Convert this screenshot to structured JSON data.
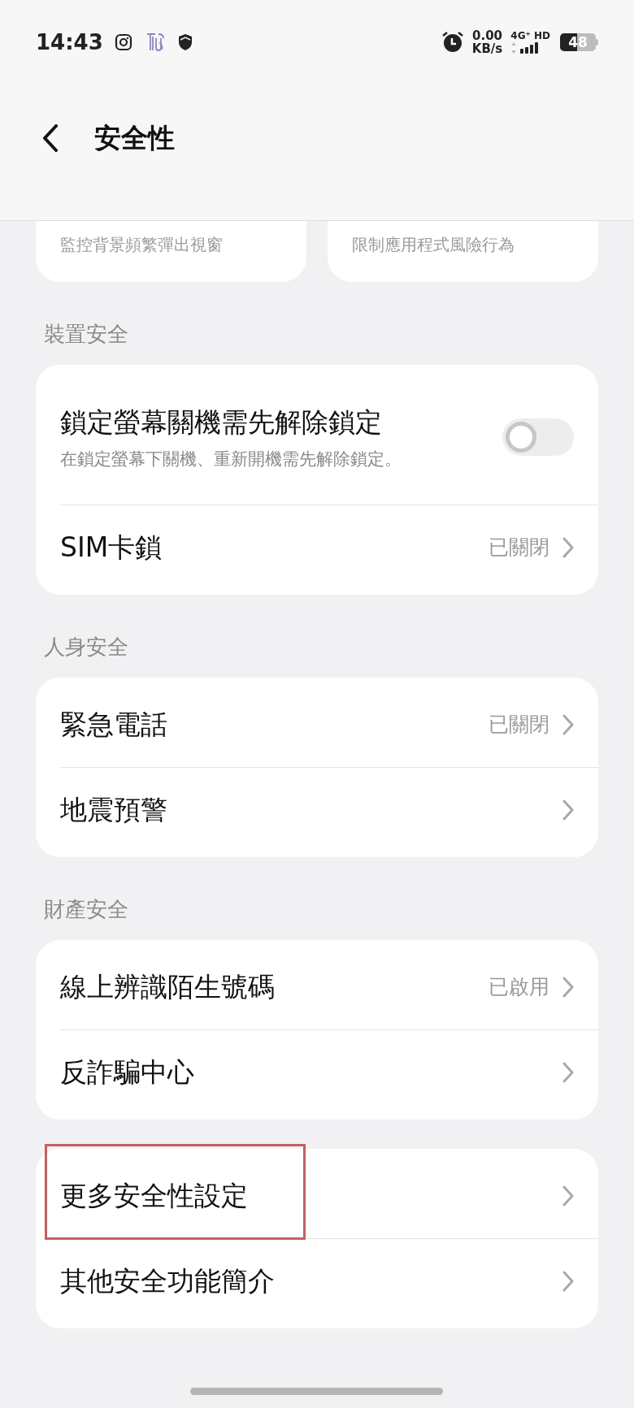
{
  "status_bar": {
    "time": "14:43",
    "net_speed": "0.00",
    "net_unit": "KB/s",
    "network": "4G⁺ HD",
    "battery": "48"
  },
  "header": {
    "title": "安全性"
  },
  "top_cards": [
    {
      "subtitle": "監控背景頻繁彈出視窗"
    },
    {
      "subtitle": "限制應用程式風險行為"
    }
  ],
  "sections": [
    {
      "title": "裝置安全",
      "items": [
        {
          "kind": "toggle",
          "label": "鎖定螢幕關機需先解除鎖定",
          "subtitle": "在鎖定螢幕下關機、重新開機需先解除鎖定。",
          "on": false
        },
        {
          "kind": "link",
          "label": "SIM卡鎖",
          "value": "已關閉"
        }
      ]
    },
    {
      "title": "人身安全",
      "items": [
        {
          "kind": "link",
          "label": "緊急電話",
          "value": "已關閉"
        },
        {
          "kind": "link",
          "label": "地震預警"
        }
      ]
    },
    {
      "title": "財產安全",
      "items": [
        {
          "kind": "link",
          "label": "線上辨識陌生號碼",
          "value": "已啟用"
        },
        {
          "kind": "link",
          "label": "反詐騙中心"
        }
      ]
    },
    {
      "items": [
        {
          "kind": "link",
          "label": "更多安全性設定",
          "highlighted": true
        },
        {
          "kind": "link",
          "label": "其他安全功能簡介",
          "highlighted": false
        }
      ]
    }
  ]
}
